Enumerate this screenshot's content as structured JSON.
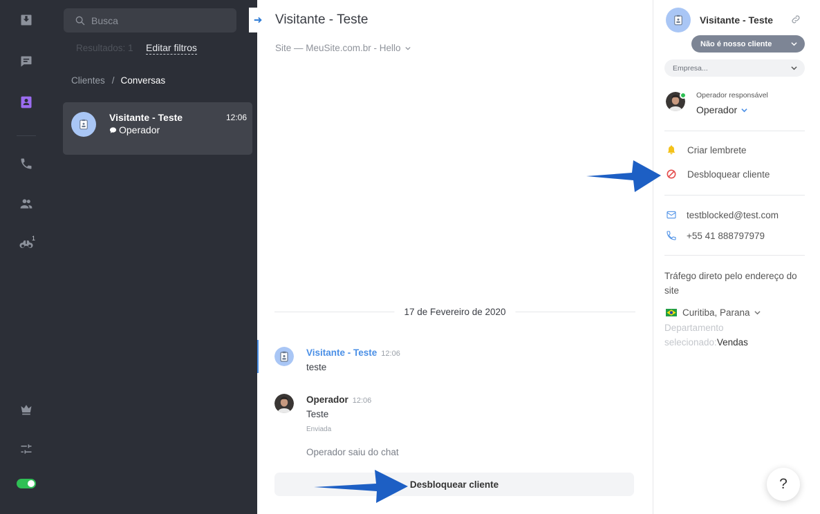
{
  "rail": {
    "icons": [
      "inbox-icon",
      "chat-icon",
      "contacts-icon",
      "phone-icon",
      "team-icon",
      "binoculars-icon",
      "crown-icon",
      "settings-sliders-icon"
    ],
    "binoculars_badge": "1"
  },
  "list": {
    "search_placeholder": "Busca",
    "results_label": "Resultados: 1",
    "edit_filters": "Editar filtros",
    "breadcrumb": {
      "parent": "Clientes",
      "separator": "/",
      "current": "Conversas"
    },
    "conversation": {
      "name": "Visitante - Teste",
      "time": "12:06",
      "subtitle": "Operador"
    }
  },
  "chat": {
    "title": "Visitante - Teste",
    "subtitle": "Site — MeuSite.com.br - Hello",
    "date_separator": "17 de Fevereiro de 2020",
    "messages": [
      {
        "author": "Visitante - Teste",
        "time": "12:06",
        "text": "teste",
        "author_color": "#4a8fe6"
      },
      {
        "author": "Operador",
        "time": "12:06",
        "text": "Teste",
        "status": "Enviada",
        "author_color": "#333333"
      }
    ],
    "system_message": "Operador saiu do chat",
    "unblock_button": "Desbloquear cliente"
  },
  "info": {
    "name": "Visitante - Teste",
    "client_status": "Não é nosso cliente",
    "company_placeholder": "Empresa...",
    "operator_label": "Operador responsável",
    "operator_name": "Operador",
    "actions": {
      "reminder": "Criar lembrete",
      "unblock": "Desbloquear cliente"
    },
    "email": "testblocked@test.com",
    "phone": "+55 41 888797979",
    "traffic": "Tráfego direto pelo endereço do site",
    "location": "Curitiba, Parana",
    "department_label": "Departamento selecionado:",
    "department_value": "Vendas"
  },
  "help_label": "?",
  "colors": {
    "rail_bg": "#2c2f37",
    "accent_purple": "#9b6cf0",
    "accent_blue": "#4a8fe6",
    "online_green": "#2fbf55",
    "block_red": "#e44b4b",
    "bell_yellow": "#f4c21b",
    "annotation_arrow": "#1d5fc4"
  }
}
